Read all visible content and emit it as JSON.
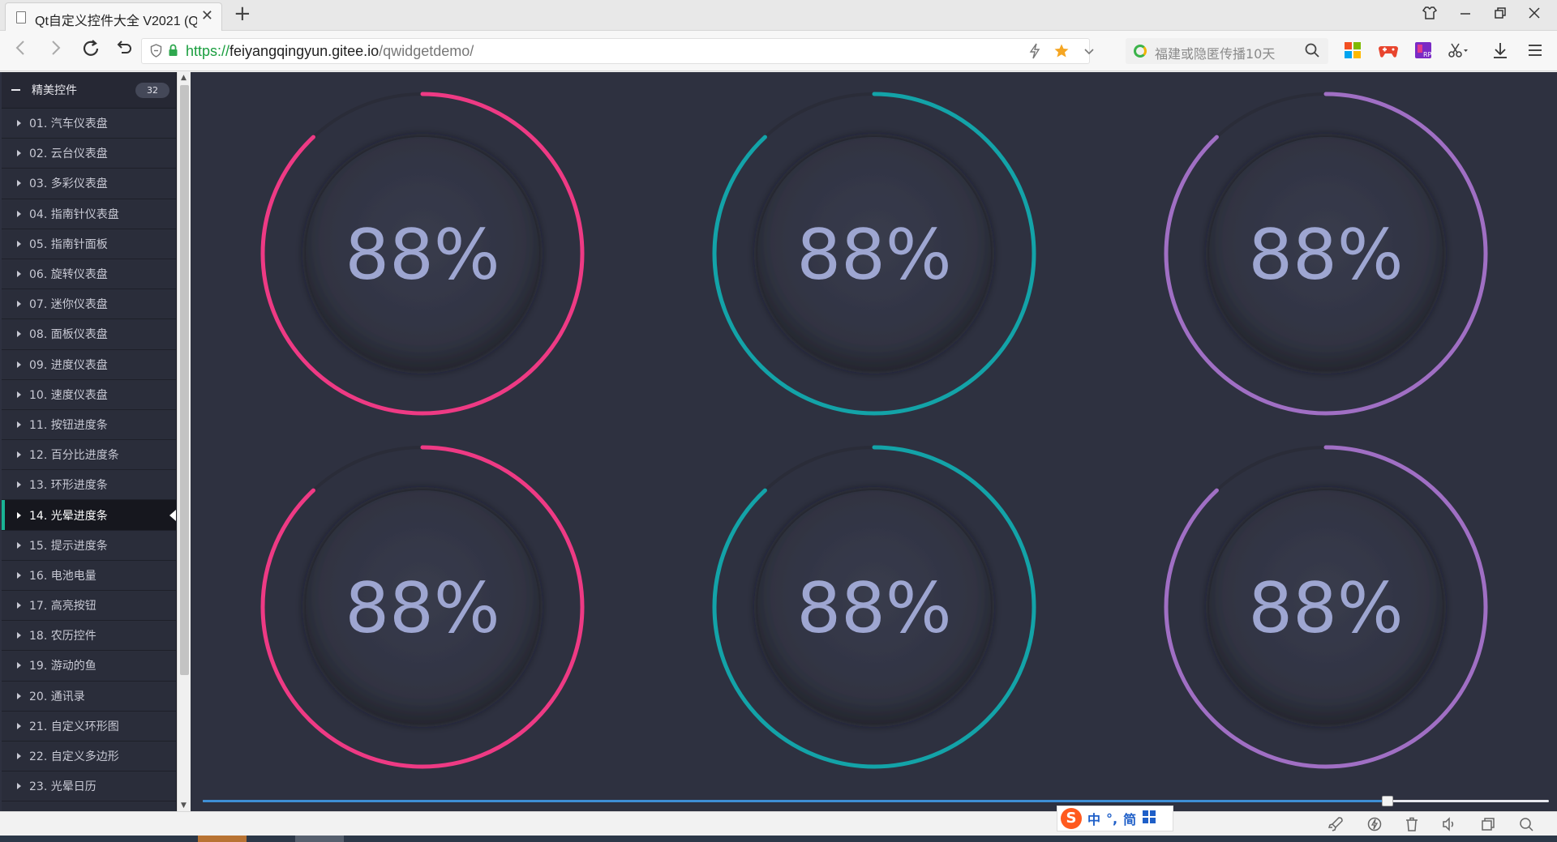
{
  "browser": {
    "tab_title": "Qt自定义控件大全 V2021 (Q",
    "tab_close": "✕",
    "new_tab": "+",
    "url_scheme": "https://",
    "url_host": "feiyangqingyun.gitee.io",
    "url_path": "/qwidgetdemo/",
    "search_placeholder": "福建或隐匿传播10天"
  },
  "sidebar": {
    "group_label": "精美控件",
    "group_count": "32",
    "items": [
      {
        "label": "01. 汽车仪表盘"
      },
      {
        "label": "02. 云台仪表盘"
      },
      {
        "label": "03. 多彩仪表盘"
      },
      {
        "label": "04. 指南针仪表盘"
      },
      {
        "label": "05. 指南针面板"
      },
      {
        "label": "06. 旋转仪表盘"
      },
      {
        "label": "07. 迷你仪表盘"
      },
      {
        "label": "08. 面板仪表盘"
      },
      {
        "label": "09. 进度仪表盘"
      },
      {
        "label": "10. 速度仪表盘"
      },
      {
        "label": "11. 按钮进度条"
      },
      {
        "label": "12. 百分比进度条"
      },
      {
        "label": "13. 环形进度条"
      },
      {
        "label": "14. 光晕进度条"
      },
      {
        "label": "15. 提示进度条"
      },
      {
        "label": "16. 电池电量"
      },
      {
        "label": "17. 高亮按钮"
      },
      {
        "label": "18. 农历控件"
      },
      {
        "label": "19. 游动的鱼"
      },
      {
        "label": "20. 通讯录"
      },
      {
        "label": "21. 自定义环形图"
      },
      {
        "label": "22. 自定义多边形"
      },
      {
        "label": "23. 光晕日历"
      }
    ],
    "active_index": 13
  },
  "gauges": [
    {
      "text": "88%",
      "value": 88,
      "color": "#ee3a84"
    },
    {
      "text": "88%",
      "value": 88,
      "color": "#13a3a8"
    },
    {
      "text": "88%",
      "value": 88,
      "color": "#a06fc4"
    },
    {
      "text": "88%",
      "value": 88,
      "color": "#ee3a84"
    },
    {
      "text": "88%",
      "value": 88,
      "color": "#13a3a8"
    },
    {
      "text": "88%",
      "value": 88,
      "color": "#a06fc4"
    }
  ],
  "slider": {
    "value": 88,
    "fill_color": "#3e8fd6"
  },
  "ime": {
    "lang": "中",
    "punct": "°,",
    "mode": "简"
  }
}
